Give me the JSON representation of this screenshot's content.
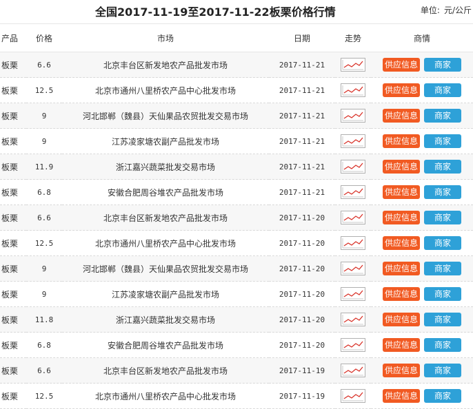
{
  "header": {
    "title": "全国2017-11-19至2017-11-22板栗价格行情",
    "unit_label": "单位:",
    "unit_value": "元/公斤"
  },
  "table": {
    "columns": {
      "product": "产品",
      "price": "价格",
      "market": "市场",
      "date": "日期",
      "trend": "走势",
      "business": "商情"
    },
    "buttons": {
      "supply": "供应信息",
      "merchant": "商家"
    },
    "icons": {
      "trend": "trend-chart-icon"
    },
    "colors": {
      "supply_button": "#f15a22",
      "merchant_button": "#2ea1d8",
      "trend_line": "#d9332a"
    },
    "rows": [
      {
        "product": "板栗",
        "price": "6.6",
        "market": "北京丰台区新发地农产品批发市场",
        "date": "2017-11-21"
      },
      {
        "product": "板栗",
        "price": "12.5",
        "market": "北京市通州八里桥农产品中心批发市场",
        "date": "2017-11-21"
      },
      {
        "product": "板栗",
        "price": "9",
        "market": "河北邯郸（魏县）天仙果品农贸批发交易市场",
        "date": "2017-11-21"
      },
      {
        "product": "板栗",
        "price": "9",
        "market": "江苏凌家塘农副产品批发市场",
        "date": "2017-11-21"
      },
      {
        "product": "板栗",
        "price": "11.9",
        "market": "浙江嘉兴蔬菜批发交易市场",
        "date": "2017-11-21"
      },
      {
        "product": "板栗",
        "price": "6.8",
        "market": "安徽合肥周谷堆农产品批发市场",
        "date": "2017-11-21"
      },
      {
        "product": "板栗",
        "price": "6.6",
        "market": "北京丰台区新发地农产品批发市场",
        "date": "2017-11-20"
      },
      {
        "product": "板栗",
        "price": "12.5",
        "market": "北京市通州八里桥农产品中心批发市场",
        "date": "2017-11-20"
      },
      {
        "product": "板栗",
        "price": "9",
        "market": "河北邯郸（魏县）天仙果品农贸批发交易市场",
        "date": "2017-11-20"
      },
      {
        "product": "板栗",
        "price": "9",
        "market": "江苏凌家塘农副产品批发市场",
        "date": "2017-11-20"
      },
      {
        "product": "板栗",
        "price": "11.8",
        "market": "浙江嘉兴蔬菜批发交易市场",
        "date": "2017-11-20"
      },
      {
        "product": "板栗",
        "price": "6.8",
        "market": "安徽合肥周谷堆农产品批发市场",
        "date": "2017-11-20"
      },
      {
        "product": "板栗",
        "price": "6.6",
        "market": "北京丰台区新发地农产品批发市场",
        "date": "2017-11-19"
      },
      {
        "product": "板栗",
        "price": "12.5",
        "market": "北京市通州八里桥农产品中心批发市场",
        "date": "2017-11-19"
      }
    ]
  }
}
